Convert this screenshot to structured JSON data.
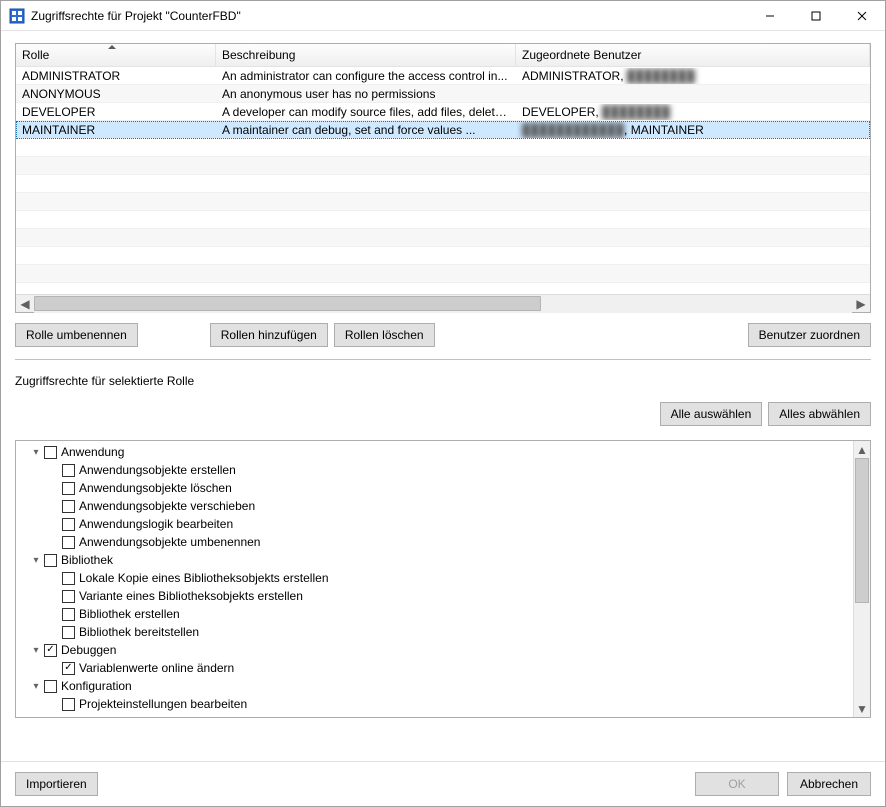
{
  "window": {
    "title": "Zugriffsrechte für Projekt \"CounterFBD\""
  },
  "table": {
    "headers": {
      "role": "Rolle",
      "desc": "Beschreibung",
      "users": "Zugeordnete Benutzer"
    },
    "rows": [
      {
        "role": "ADMINISTRATOR",
        "desc": "An administrator can configure the access control in...",
        "users_prefix": "ADMINISTRATOR, ",
        "users_blur": "████████",
        "users_suffix": ""
      },
      {
        "role": "ANONYMOUS",
        "desc": "An anonymous user has no permissions",
        "users_prefix": "",
        "users_blur": "",
        "users_suffix": ""
      },
      {
        "role": "DEVELOPER",
        "desc": "A developer can modify source files, add files, delete...",
        "users_prefix": "DEVELOPER, ",
        "users_blur": "████████",
        "users_suffix": ""
      },
      {
        "role": "MAINTAINER",
        "desc": "A maintainer can debug, set and force values ...",
        "users_prefix": "",
        "users_blur": "████████████",
        "users_suffix": ", MAINTAINER"
      }
    ]
  },
  "buttons": {
    "rename": "Rolle umbenennen",
    "add": "Rollen hinzufügen",
    "delete": "Rollen löschen",
    "assign": "Benutzer zuordnen",
    "select_all": "Alle auswählen",
    "deselect_all": "Alles abwählen",
    "import": "Importieren",
    "ok": "OK",
    "cancel": "Abbrechen"
  },
  "section_title": "Zugriffsrechte für selektierte Rolle",
  "tree": [
    {
      "level": 1,
      "expander": "open",
      "checked": false,
      "label": "Anwendung"
    },
    {
      "level": 2,
      "expander": "none",
      "checked": false,
      "label": "Anwendungsobjekte erstellen"
    },
    {
      "level": 2,
      "expander": "none",
      "checked": false,
      "label": "Anwendungsobjekte löschen"
    },
    {
      "level": 2,
      "expander": "none",
      "checked": false,
      "label": "Anwendungsobjekte verschieben"
    },
    {
      "level": 2,
      "expander": "none",
      "checked": false,
      "label": "Anwendungslogik bearbeiten"
    },
    {
      "level": 2,
      "expander": "none",
      "checked": false,
      "label": "Anwendungsobjekte umbenennen"
    },
    {
      "level": 1,
      "expander": "open",
      "checked": false,
      "label": "Bibliothek"
    },
    {
      "level": 2,
      "expander": "none",
      "checked": false,
      "label": "Lokale Kopie eines Bibliotheksobjekts erstellen"
    },
    {
      "level": 2,
      "expander": "none",
      "checked": false,
      "label": "Variante eines Bibliotheksobjekts erstellen"
    },
    {
      "level": 2,
      "expander": "none",
      "checked": false,
      "label": "Bibliothek erstellen"
    },
    {
      "level": 2,
      "expander": "none",
      "checked": false,
      "label": "Bibliothek bereitstellen"
    },
    {
      "level": 1,
      "expander": "open",
      "checked": true,
      "label": "Debuggen"
    },
    {
      "level": 2,
      "expander": "none",
      "checked": true,
      "label": "Variablenwerte online ändern"
    },
    {
      "level": 1,
      "expander": "open",
      "checked": false,
      "label": "Konfiguration"
    },
    {
      "level": 2,
      "expander": "none",
      "checked": false,
      "label": "Projekteinstellungen bearbeiten"
    }
  ]
}
